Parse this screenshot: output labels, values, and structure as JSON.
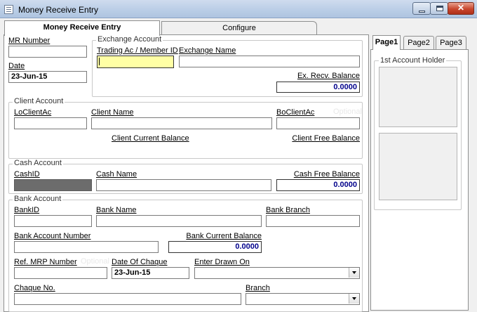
{
  "window": {
    "title": "Money Receive Entry"
  },
  "tabs": [
    {
      "label": "Money Receive Entry"
    },
    {
      "label": "Configure"
    }
  ],
  "header": {
    "mr_number_label": "MR Number",
    "mr_number_value": "",
    "date_label": "Date",
    "date_value": "23-Jun-15"
  },
  "exchange_account": {
    "title": "Exchange Account",
    "trading_ac_label": "Trading Ac / Member ID",
    "trading_ac_value": "",
    "exchange_name_label": "Exchange Name",
    "exchange_name_value": "",
    "balance_label": "Ex. Recv. Balance",
    "balance_value": "0.0000"
  },
  "client_account": {
    "title": "Client Account",
    "lo_client_ac_label": "LoClientAc",
    "client_name_label": "Client Name",
    "bo_client_ac_label": "BoClientAc",
    "optional_hint": "Optional",
    "current_balance_label": "Client Current Balance",
    "free_balance_label": "Client Free Balance"
  },
  "cash_account": {
    "title": "Cash Account",
    "cash_id_label": "CashID",
    "cash_name_label": "Cash Name",
    "free_balance_label": "Cash Free Balance",
    "free_balance_value": "0.0000"
  },
  "bank_account": {
    "title": "Bank Account",
    "bank_id_label": "BankID",
    "bank_name_label": "Bank Name",
    "bank_branch_label": "Bank Branch",
    "account_number_label": "Bank Account Number",
    "current_balance_label": "Bank Current Balance",
    "current_balance_value": "0.0000",
    "ref_mrp_label": "Ref. MRP Number",
    "optional_hint": "Optional",
    "date_of_chaque_label": "Date Of Chaque",
    "date_of_chaque_value": "23-Jun-15",
    "drawn_on_label": "Enter Drawn On",
    "chaque_no_label": "Chaque No.",
    "branch_label": "Branch"
  },
  "side_panel": {
    "tabs": [
      {
        "label": "Page1"
      },
      {
        "label": "Page2"
      },
      {
        "label": "Page3"
      }
    ],
    "group_title": "1st Account Holder"
  }
}
